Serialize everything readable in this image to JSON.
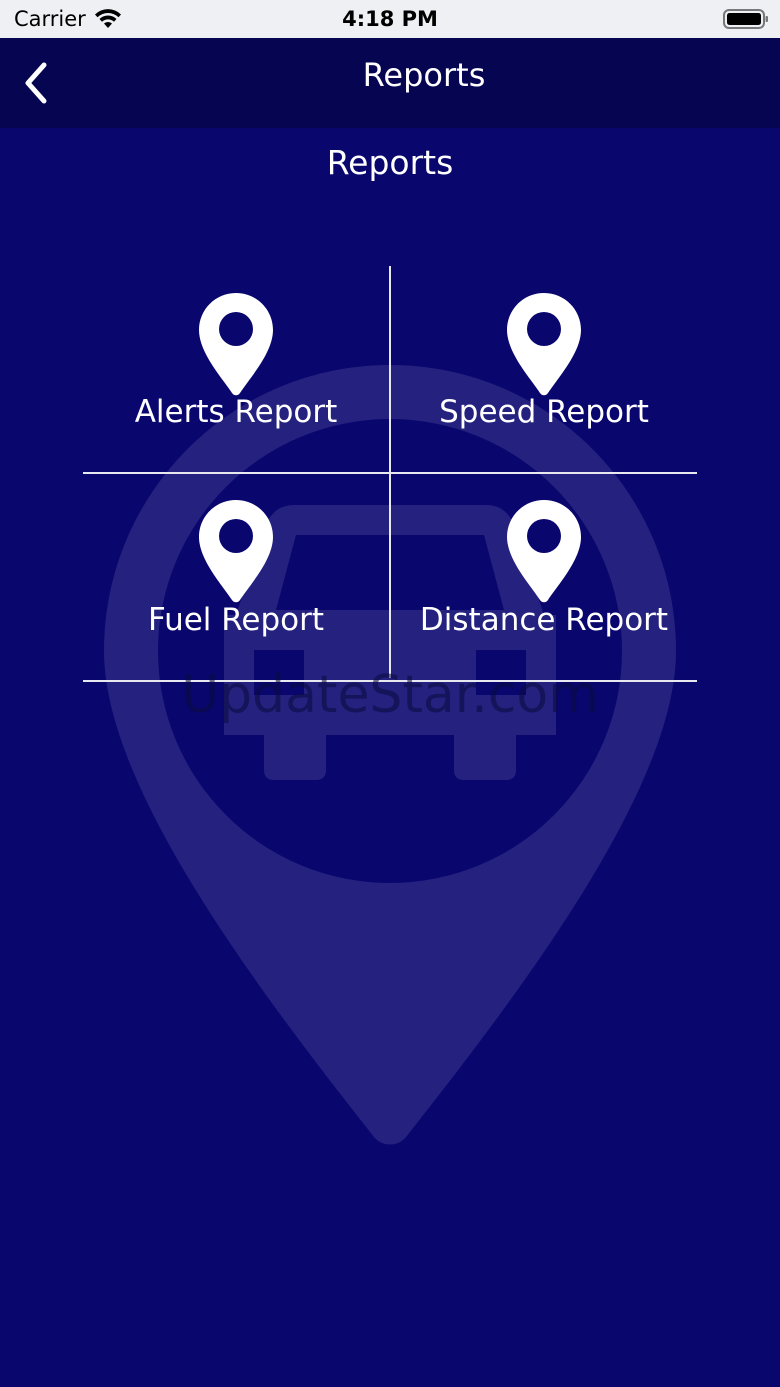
{
  "status_bar": {
    "carrier": "Carrier",
    "time": "4:18 PM"
  },
  "nav": {
    "title": "Reports",
    "back_icon": "chevron-left-icon"
  },
  "page": {
    "heading": "Reports"
  },
  "reports": [
    {
      "label": "Alerts Report",
      "icon": "map-pin-icon"
    },
    {
      "label": "Speed Report",
      "icon": "map-pin-icon"
    },
    {
      "label": "Fuel Report",
      "icon": "map-pin-icon"
    },
    {
      "label": "Distance Report",
      "icon": "map-pin-icon"
    }
  ],
  "watermark": {
    "text": "UpdateStar.com",
    "icon": "car-location-pin-icon"
  },
  "colors": {
    "background": "#09076e",
    "nav_bar": "#050552",
    "status_bar": "#eef0f3",
    "text": "#ffffff"
  }
}
